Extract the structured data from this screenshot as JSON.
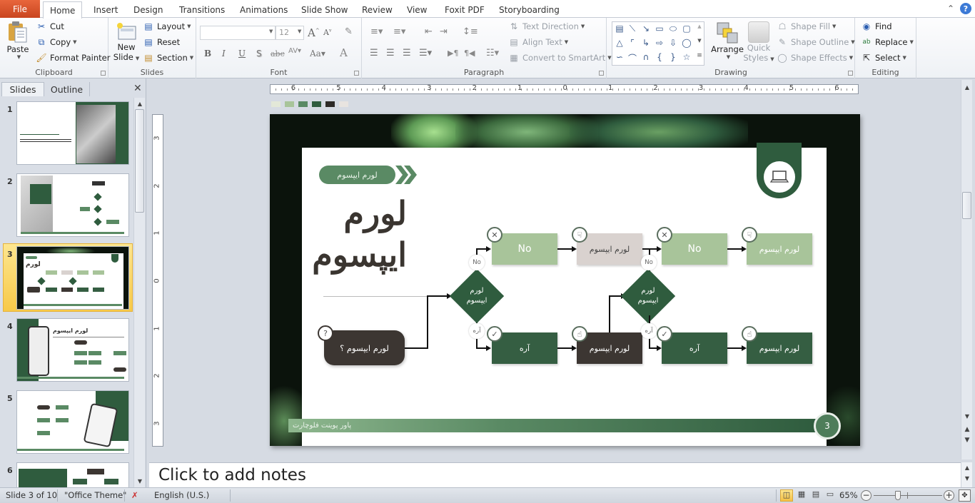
{
  "ribbon_tabs": {
    "file": "File",
    "home": "Home",
    "insert": "Insert",
    "design": "Design",
    "transitions": "Transitions",
    "animations": "Animations",
    "slide_show": "Slide Show",
    "review": "Review",
    "view": "View",
    "foxit_pdf": "Foxit PDF",
    "storyboarding": "Storyboarding"
  },
  "clipboard": {
    "paste": "Paste",
    "cut": "Cut",
    "copy": "Copy",
    "format_painter": "Format Painter",
    "label": "Clipboard"
  },
  "slides_group": {
    "new_slide_1": "New",
    "new_slide_2": "Slide",
    "layout": "Layout",
    "reset": "Reset",
    "section": "Section",
    "label": "Slides"
  },
  "font": {
    "font_name": "",
    "font_size": "12",
    "label": "Font"
  },
  "paragraph": {
    "text_direction": "Text Direction",
    "align_text": "Align Text",
    "convert_smartart": "Convert to SmartArt",
    "label": "Paragraph"
  },
  "drawing": {
    "arrange": "Arrange",
    "quick_styles_1": "Quick",
    "quick_styles_2": "Styles",
    "shape_fill": "Shape Fill",
    "shape_outline": "Shape Outline",
    "shape_effects": "Shape Effects",
    "label": "Drawing"
  },
  "editing": {
    "find": "Find",
    "replace": "Replace",
    "select": "Select",
    "label": "Editing"
  },
  "left_pane": {
    "tab_slides": "Slides",
    "tab_outline": "Outline",
    "thumbnails": [
      {
        "number": "1",
        "selected": false
      },
      {
        "number": "2",
        "selected": false
      },
      {
        "number": "3",
        "selected": true
      },
      {
        "number": "4",
        "selected": false
      },
      {
        "number": "5",
        "selected": false
      },
      {
        "number": "6",
        "selected": false
      }
    ]
  },
  "ruler": {
    "h_ticks": [
      "6",
      "5",
      "4",
      "3",
      "2",
      "1",
      "0",
      "1",
      "2",
      "3",
      "4",
      "5",
      "6"
    ],
    "v_ticks": [
      "3",
      "2",
      "1",
      "0",
      "1",
      "2",
      "3"
    ]
  },
  "theme_colors": [
    "#e3e8d8",
    "#a8c49a",
    "#5a8a64",
    "#2f5c3e",
    "#2d2a27",
    "#e8e4e0"
  ],
  "slide": {
    "pill_label": "لورم ایپسوم",
    "title_line1": "لورم",
    "title_line2": "ایپسوم",
    "start_label": "لورم ایپسوم ؟",
    "start_icon": "?",
    "diamond1_line1": "لورم",
    "diamond1_line2": "ایپسوم",
    "diamond2_line1": "لورم",
    "diamond2_line2": "ایپسوم",
    "no_label": "No",
    "yes_label": "آره",
    "box_no1": "No",
    "box_gray": "لورم ایپسوم",
    "box_no2": "No",
    "box_light_end": "لورم ایپسوم",
    "box_yes1": "آره",
    "box_brown": "لورم ایپسوم",
    "box_yes2": "آره",
    "box_dark_end": "لورم ایپسوم",
    "footer_text": "پاور پوینت فلوچارت",
    "page_number": "3",
    "colors": {
      "dark_green": "#2f5c3e",
      "mid_green": "#5a8a64",
      "light_green": "#a8c49a",
      "brown": "#3c3632",
      "gray": "#d9d2cf"
    }
  },
  "notes": {
    "placeholder": "Click to add notes"
  },
  "status_bar": {
    "slide_info": "Slide 3 of 10",
    "theme": "\"Office Theme\"",
    "language": "English (U.S.)",
    "zoom": "65%",
    "zoom_fraction": 0.35
  }
}
